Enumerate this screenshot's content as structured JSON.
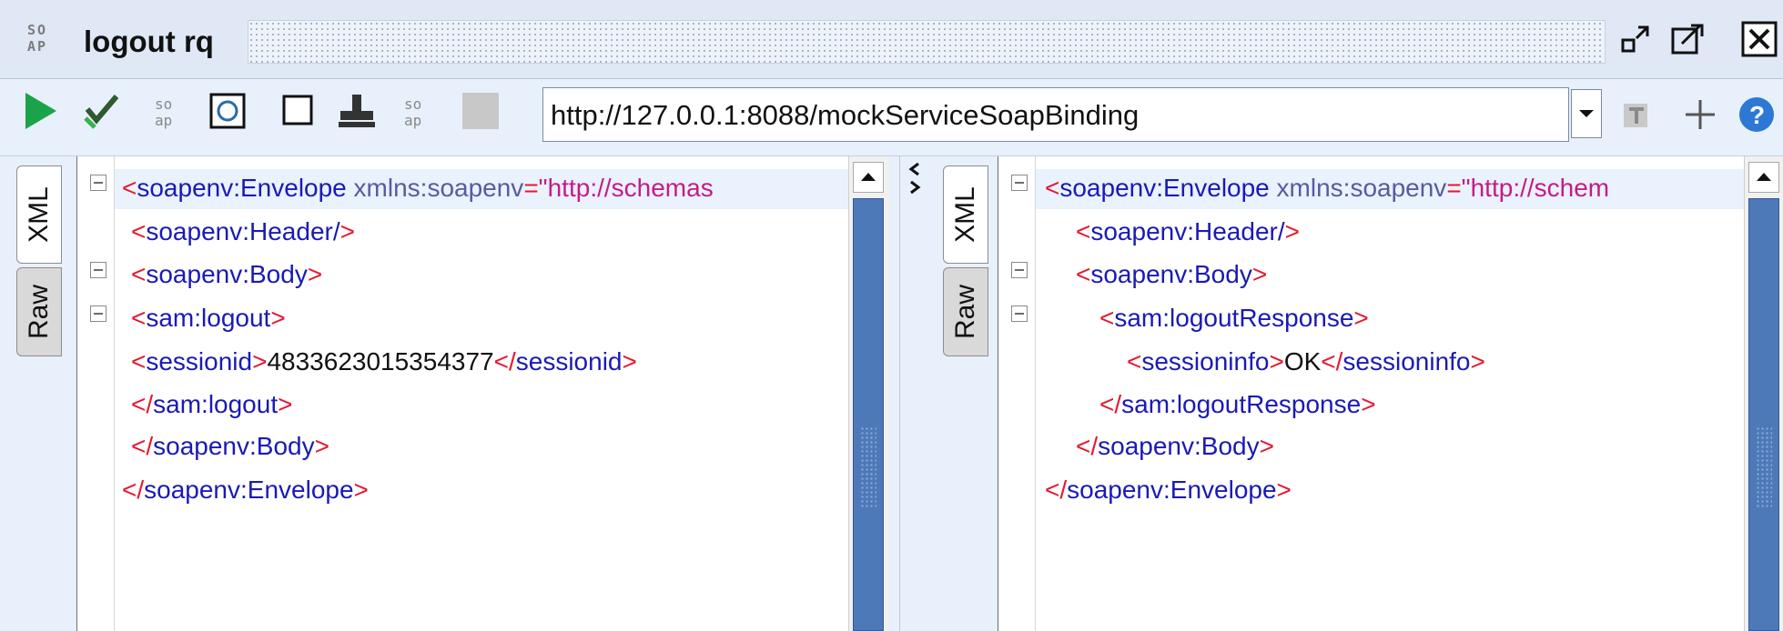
{
  "window": {
    "logo_top": "SO",
    "logo_bottom": "AP",
    "title": "logout rq",
    "icons": [
      "detach-icon",
      "maximize-icon",
      "close-icon"
    ]
  },
  "toolbar": {
    "icons": [
      "run-icon",
      "check-icon",
      "dots-icon",
      "refresh-frame-icon",
      "square-icon",
      "stamp-icon",
      "dots-icon",
      "stop-icon"
    ],
    "url": "http://127.0.0.1:8088/mockServiceSoapBinding",
    "right_icons": [
      "tb-icon",
      "plus-icon",
      "help-icon"
    ]
  },
  "request": {
    "tabs": [
      "XML",
      "Raw"
    ],
    "lines": [
      {
        "open": "<",
        "tag": "soapenv:Envelope",
        "attr": " xmlns:soapenv",
        "eq": "=",
        "str": "\"http://schemas",
        "close": ""
      },
      {
        "open": "<",
        "tag": "soapenv:Header/",
        "close": ">"
      },
      {
        "open": "<",
        "tag": "soapenv:Body",
        "close": ">"
      },
      {
        "open": "<",
        "tag": "sam:logout",
        "close": ">"
      },
      {
        "open": "<",
        "tag": "sessionid",
        "close": ">",
        "text": "4833623015354377",
        "open2": "</",
        "tag2": "sessionid",
        "close2": ">"
      },
      {
        "open": "</",
        "tag": "sam:logout",
        "close": ">"
      },
      {
        "open": "</",
        "tag": "soapenv:Body",
        "close": ">"
      },
      {
        "open": "</",
        "tag": "soapenv:Envelope",
        "close": ">"
      }
    ]
  },
  "response": {
    "tabs": [
      "XML",
      "Raw"
    ],
    "lines": [
      {
        "open": "<",
        "tag": "soapenv:Envelope",
        "attr": " xmlns:soapenv",
        "eq": "=",
        "str": "\"http://schem",
        "close": ""
      },
      {
        "open": "<",
        "tag": "soapenv:Header/",
        "close": ">"
      },
      {
        "open": "<",
        "tag": "soapenv:Body",
        "close": ">"
      },
      {
        "open": "<",
        "tag": "sam:logoutResponse",
        "close": ">"
      },
      {
        "open": "<",
        "tag": "sessioninfo",
        "close": ">",
        "text": "OK",
        "open2": "</",
        "tag2": "sessioninfo",
        "close2": ">"
      },
      {
        "open": "</",
        "tag": "sam:logoutResponse",
        "close": ">"
      },
      {
        "open": "</",
        "tag": "soapenv:Body",
        "close": ">"
      },
      {
        "open": "</",
        "tag": "soapenv:Envelope",
        "close": ">"
      }
    ]
  },
  "colors": {
    "tag": "#1a1ab5",
    "bracket": "#e5172f",
    "string": "#c51b8a",
    "attr": "#5a5aa0",
    "scroll_thumb": "#4e79b8"
  }
}
